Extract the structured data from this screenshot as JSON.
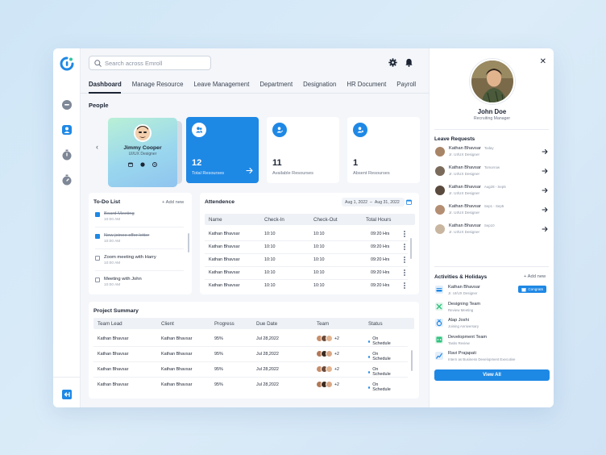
{
  "search": {
    "placeholder": "Search across Emroll"
  },
  "nav": [
    "Dashboard",
    "Manage Resource",
    "Leave Management",
    "Department",
    "Designation",
    "HR Document",
    "Payroll"
  ],
  "people": {
    "title": "People",
    "card": {
      "name": "Jimmy Cooper",
      "role": "UI/UX Designer"
    },
    "stats": [
      {
        "value": "12",
        "label": "Total Resourses"
      },
      {
        "value": "11",
        "label": "Available Resourses"
      },
      {
        "value": "1",
        "label": "Absent Resourses"
      }
    ]
  },
  "todo": {
    "title": "To-Do List",
    "add_label": "+ Add new",
    "items": [
      {
        "text": "Board Meeting",
        "time": "10:00 AM",
        "done": true
      },
      {
        "text": "New joinee offer letter",
        "time": "10:00 AM",
        "done": true
      },
      {
        "text": "Zoom meeting with Harry",
        "time": "10:00 AM",
        "done": false
      },
      {
        "text": "Meeting with John",
        "time": "10:00 AM",
        "done": false
      }
    ]
  },
  "attendance": {
    "title": "Attendence",
    "date_from": "Aug 1, 2022",
    "date_to": "Aug 31, 2022",
    "columns": [
      "Name",
      "Check-In",
      "Check-Out",
      "Total Hours"
    ],
    "rows": [
      [
        "Kathan Bhavsar",
        "10:10",
        "10:10",
        "09:20 Hrs"
      ],
      [
        "Kathan Bhavsar",
        "10:10",
        "10:10",
        "09:20 Hrs"
      ],
      [
        "Kathan Bhavsar",
        "10:10",
        "10:10",
        "09:20 Hrs"
      ],
      [
        "Kathan Bhavsar",
        "10:10",
        "10:10",
        "09:20 Hrs"
      ],
      [
        "Kathan Bhavsar",
        "10:10",
        "10:10",
        "09:20 Hrs"
      ]
    ]
  },
  "projects": {
    "title": "Project Summary",
    "columns": [
      "Team Lead",
      "Client",
      "Progress",
      "Due Date",
      "Team",
      "Status"
    ],
    "rows": [
      [
        "Kathan Bhavsar",
        "Kathan Bhavsar",
        "95%",
        "Jul 28,2022",
        "+2",
        "On Schedule"
      ],
      [
        "Kathan Bhavsar",
        "Kathan Bhavsar",
        "95%",
        "Jul 28,2022",
        "+2",
        "On Schedule"
      ],
      [
        "Kathan Bhavsar",
        "Kathan Bhavsar",
        "95%",
        "Jul 28,2022",
        "+2",
        "On Schedule"
      ],
      [
        "Kathan Bhavsar",
        "Kathan Bhavsar",
        "95%",
        "Jul 28,2022",
        "+2",
        "On Schedule"
      ]
    ]
  },
  "profile": {
    "name": "John Doe",
    "role": "Recruiting Manager"
  },
  "leave_requests": {
    "title": "Leave Requests",
    "items": [
      {
        "name": "Kathan Bhavsar",
        "date": "Today",
        "role": "Jr. UI/UX Designer"
      },
      {
        "name": "Kathan Bhavsar",
        "date": "Tomorrow",
        "role": "Jr. UI/UX Designer"
      },
      {
        "name": "Kathan Bhavsar",
        "date": "Aug28 - Sep5",
        "role": "Jr. UI/UX Designer"
      },
      {
        "name": "Kathan Bhavsar",
        "date": "Sep1 - Sep5",
        "role": "Jr. UI/UX Designer"
      },
      {
        "name": "Kathan Bhavsar",
        "date": "Sep10",
        "role": "Jr. UI/UX Designer"
      }
    ]
  },
  "activities": {
    "title": "Activities & Holidays",
    "add_label": "+ Add new",
    "congrats_label": "Congrats",
    "view_all": "View All",
    "items": [
      {
        "name": "Kathan Bhavsar",
        "sub": "Jr. UI/UX Designer"
      },
      {
        "name": "Designing Team",
        "sub": "Review Meeting"
      },
      {
        "name": "Alap Joshi",
        "sub": "Joining Anniversary"
      },
      {
        "name": "Development Team",
        "sub": "Tasks Review"
      },
      {
        "name": "Ravi Prajapati",
        "sub": "Intern as Business Development Executive"
      }
    ]
  },
  "colors": {
    "accent": "#1e88e5",
    "text": "#1c2434",
    "background": "#f4f6fa"
  }
}
